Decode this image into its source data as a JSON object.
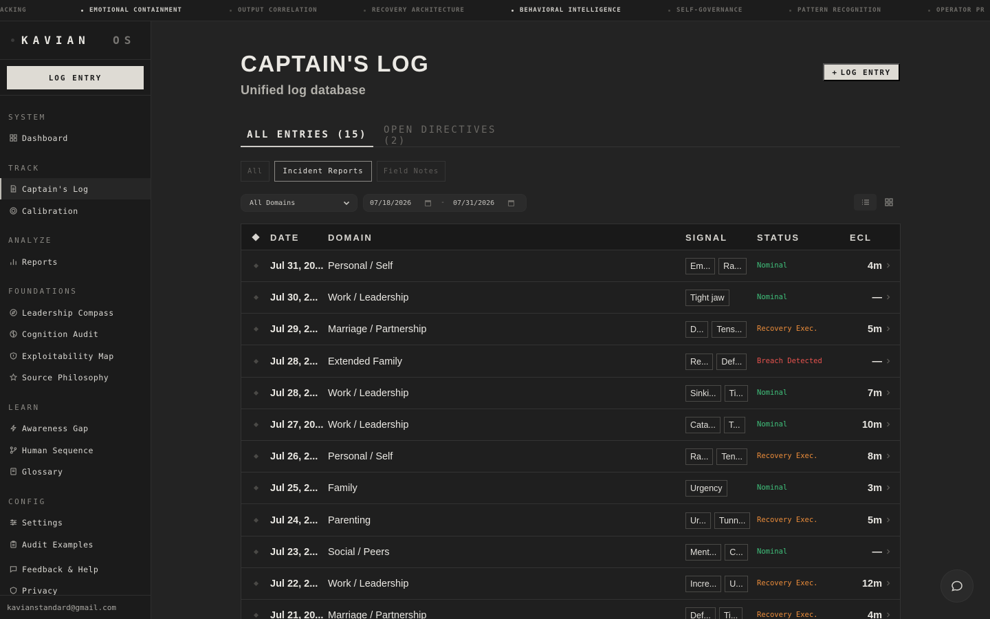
{
  "ticker": [
    {
      "label": "ACKING",
      "highlight": false
    },
    {
      "label": "EMOTIONAL CONTAINMENT",
      "highlight": true
    },
    {
      "label": "OUTPUT CORRELATION",
      "highlight": false
    },
    {
      "label": "RECOVERY ARCHITECTURE",
      "highlight": false
    },
    {
      "label": "BEHAVIORAL INTELLIGENCE",
      "highlight": true
    },
    {
      "label": "SELF-GOVERNANCE",
      "highlight": false
    },
    {
      "label": "PATTERN RECOGNITION",
      "highlight": false
    },
    {
      "label": "OPERATOR PR",
      "highlight": false
    }
  ],
  "sidebar": {
    "brand_main": "KAVIAN",
    "brand_suffix": "OS",
    "log_entry_label": "LOG ENTRY",
    "sections": {
      "system": "SYSTEM",
      "track": "TRACK",
      "analyze": "ANALYZE",
      "foundations": "FOUNDATIONS",
      "learn": "LEARN",
      "config": "CONFIG"
    },
    "items": {
      "dashboard": "Dashboard",
      "captains_log": "Captain's Log",
      "calibration": "Calibration",
      "reports": "Reports",
      "leadership_compass": "Leadership Compass",
      "cognition_audit": "Cognition Audit",
      "exploitability_map": "Exploitability Map",
      "source_philosophy": "Source Philosophy",
      "awareness_gap": "Awareness Gap",
      "human_sequence": "Human Sequence",
      "glossary": "Glossary",
      "settings": "Settings",
      "audit_examples": "Audit Examples",
      "feedback_help": "Feedback & Help",
      "privacy": "Privacy"
    },
    "user_email": "kavianstandard@gmail.com"
  },
  "main": {
    "title": "CAPTAIN'S LOG",
    "subtitle": "Unified log database",
    "log_entry_button": "LOG ENTRY",
    "tabs": {
      "all_entries": "ALL ENTRIES (15)",
      "open_directives": "OPEN DIRECTIVES (2)"
    },
    "subtabs": {
      "all": "All",
      "incident_reports": "Incident Reports",
      "field_notes": "Field Notes"
    },
    "filters": {
      "domain_select": "All Domains",
      "date_from": "07/18/2026",
      "date_sep": "-",
      "date_to": "07/31/2026"
    },
    "table": {
      "headers": {
        "date": "DATE",
        "domain": "DOMAIN",
        "signal": "SIGNAL",
        "status": "STATUS",
        "ecl": "ECL"
      },
      "rows": [
        {
          "date": "Jul 31, 20...",
          "domain": "Personal / Self",
          "signals": [
            "Em...",
            "Ra..."
          ],
          "status": "Nominal",
          "status_type": "nominal",
          "ecl": "4m"
        },
        {
          "date": "Jul 30, 2...",
          "domain": "Work / Leadership",
          "signals": [
            "Tight jaw"
          ],
          "status": "Nominal",
          "status_type": "nominal",
          "ecl": "—"
        },
        {
          "date": "Jul 29, 2...",
          "domain": "Marriage / Partnership",
          "signals": [
            "D...",
            "Tens..."
          ],
          "status": "Recovery Exec.",
          "status_type": "recovery",
          "ecl": "5m"
        },
        {
          "date": "Jul 28, 2...",
          "domain": "Extended Family",
          "signals": [
            "Re...",
            "Def..."
          ],
          "status": "Breach Detected",
          "status_type": "breach",
          "ecl": "—"
        },
        {
          "date": "Jul 28, 2...",
          "domain": "Work / Leadership",
          "signals": [
            "Sinki...",
            "Ti..."
          ],
          "status": "Nominal",
          "status_type": "nominal",
          "ecl": "7m"
        },
        {
          "date": "Jul 27, 20...",
          "domain": "Work / Leadership",
          "signals": [
            "Cata...",
            "T..."
          ],
          "status": "Nominal",
          "status_type": "nominal",
          "ecl": "10m"
        },
        {
          "date": "Jul 26, 2...",
          "domain": "Personal / Self",
          "signals": [
            "Ra...",
            "Ten..."
          ],
          "status": "Recovery Exec.",
          "status_type": "recovery",
          "ecl": "8m"
        },
        {
          "date": "Jul 25, 2...",
          "domain": "Family",
          "signals": [
            "Urgency"
          ],
          "status": "Nominal",
          "status_type": "nominal",
          "ecl": "3m"
        },
        {
          "date": "Jul 24, 2...",
          "domain": "Parenting",
          "signals": [
            "Ur...",
            "Tunn..."
          ],
          "status": "Recovery Exec.",
          "status_type": "recovery",
          "ecl": "5m"
        },
        {
          "date": "Jul 23, 2...",
          "domain": "Social / Peers",
          "signals": [
            "Ment...",
            "C..."
          ],
          "status": "Nominal",
          "status_type": "nominal",
          "ecl": "—"
        },
        {
          "date": "Jul 22, 2...",
          "domain": "Work / Leadership",
          "signals": [
            "Incre...",
            "U..."
          ],
          "status": "Recovery Exec.",
          "status_type": "recovery",
          "ecl": "12m"
        },
        {
          "date": "Jul 21, 20...",
          "domain": "Marriage / Partnership",
          "signals": [
            "Def...",
            "Ti..."
          ],
          "status": "Recovery Exec.",
          "status_type": "recovery",
          "ecl": "4m"
        }
      ]
    }
  },
  "colors": {
    "nominal": "#3fbf7a",
    "recovery": "#e98b3a",
    "breach": "#e5524d",
    "accent_button": "#dedbd4"
  }
}
